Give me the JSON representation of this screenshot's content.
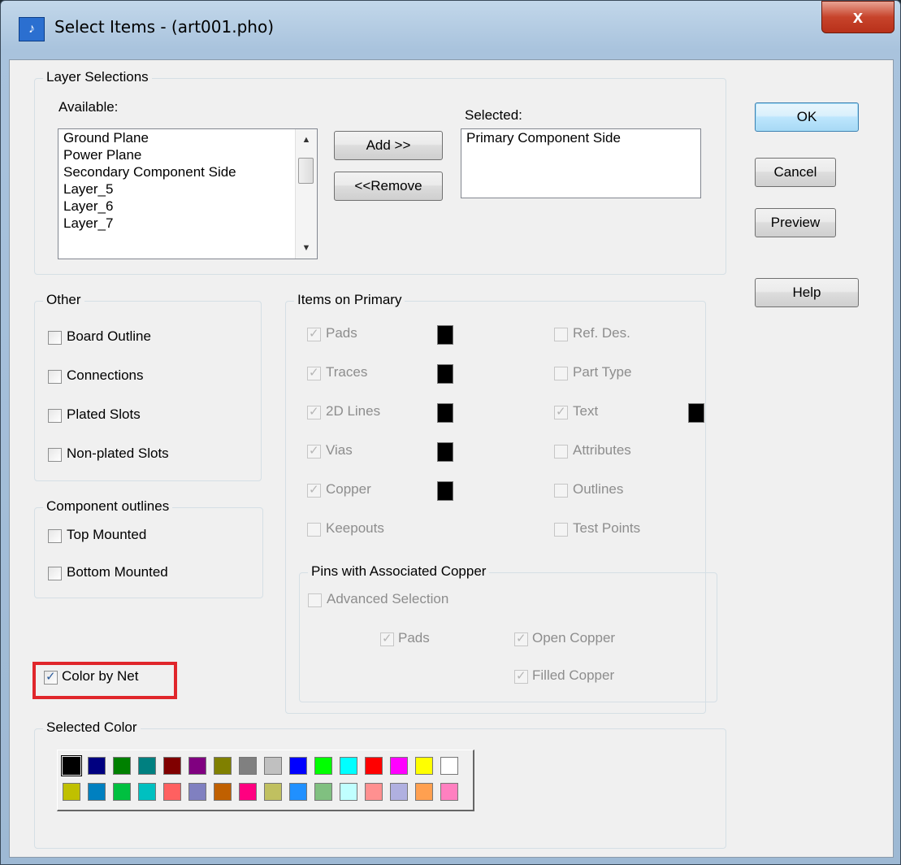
{
  "window": {
    "title": "Select Items - (art001.pho)",
    "close_label": "x"
  },
  "layer_selections": {
    "group_label": "Layer Selections",
    "available_label": "Available:",
    "selected_label": "Selected:",
    "available_items": [
      "Ground Plane",
      "Power Plane",
      "Secondary Component Side",
      "Layer_5",
      "Layer_6",
      "Layer_7"
    ],
    "selected_items": [
      "Primary Component Side"
    ],
    "add_label": "Add >>",
    "remove_label": "<<Remove"
  },
  "buttons": {
    "ok": "OK",
    "cancel": "Cancel",
    "preview": "Preview",
    "help": "Help"
  },
  "other": {
    "group_label": "Other",
    "items": [
      {
        "label": "Board Outline",
        "checked": false
      },
      {
        "label": "Connections",
        "checked": false
      },
      {
        "label": "Plated Slots",
        "checked": false
      },
      {
        "label": "Non-plated Slots",
        "checked": false
      }
    ]
  },
  "component_outlines": {
    "group_label": "Component outlines",
    "items": [
      {
        "label": "Top Mounted",
        "checked": false
      },
      {
        "label": "Bottom Mounted",
        "checked": false
      }
    ]
  },
  "color_by_net": {
    "label": "Color by Net",
    "checked": true
  },
  "items_on_primary": {
    "group_label": "Items on Primary",
    "left": [
      {
        "label": "Pads",
        "checked": true,
        "color": "#000000"
      },
      {
        "label": "Traces",
        "checked": true,
        "color": "#000000"
      },
      {
        "label": "2D Lines",
        "checked": true,
        "color": "#000000"
      },
      {
        "label": "Vias",
        "checked": true,
        "color": "#000000"
      },
      {
        "label": "Copper",
        "checked": true,
        "color": "#000000"
      },
      {
        "label": "Keepouts",
        "checked": false
      }
    ],
    "right": [
      {
        "label": "Ref. Des.",
        "checked": false
      },
      {
        "label": "Part Type",
        "checked": false
      },
      {
        "label": "Text",
        "checked": true,
        "color": "#000000"
      },
      {
        "label": "Attributes",
        "checked": false
      },
      {
        "label": "Outlines",
        "checked": false
      },
      {
        "label": "Test Points",
        "checked": false
      }
    ]
  },
  "pins_copper": {
    "group_label": "Pins with Associated Copper",
    "advanced": {
      "label": "Advanced Selection",
      "checked": false
    },
    "pads": {
      "label": "Pads",
      "checked": true
    },
    "open_copper": {
      "label": "Open Copper",
      "checked": true
    },
    "filled_copper": {
      "label": "Filled Copper",
      "checked": true
    }
  },
  "selected_color": {
    "group_label": "Selected Color",
    "selected": "#000000",
    "row1": [
      "#000000",
      "#000080",
      "#008000",
      "#008080",
      "#800000",
      "#800080",
      "#808000",
      "#808080",
      "#c0c0c0",
      "#0000ff",
      "#00ff00",
      "#00ffff",
      "#ff0000",
      "#ff00ff",
      "#ffff00",
      "#ffffff"
    ],
    "row2": [
      "#c0c000",
      "#0080c0",
      "#00c040",
      "#00c0c0",
      "#ff6060",
      "#8080c0",
      "#c06000",
      "#ff0080",
      "#c0c060",
      "#2090ff",
      "#80c080",
      "#c0ffff",
      "#ff9090",
      "#b0b0e0",
      "#ffa050",
      "#ff80c0"
    ]
  }
}
